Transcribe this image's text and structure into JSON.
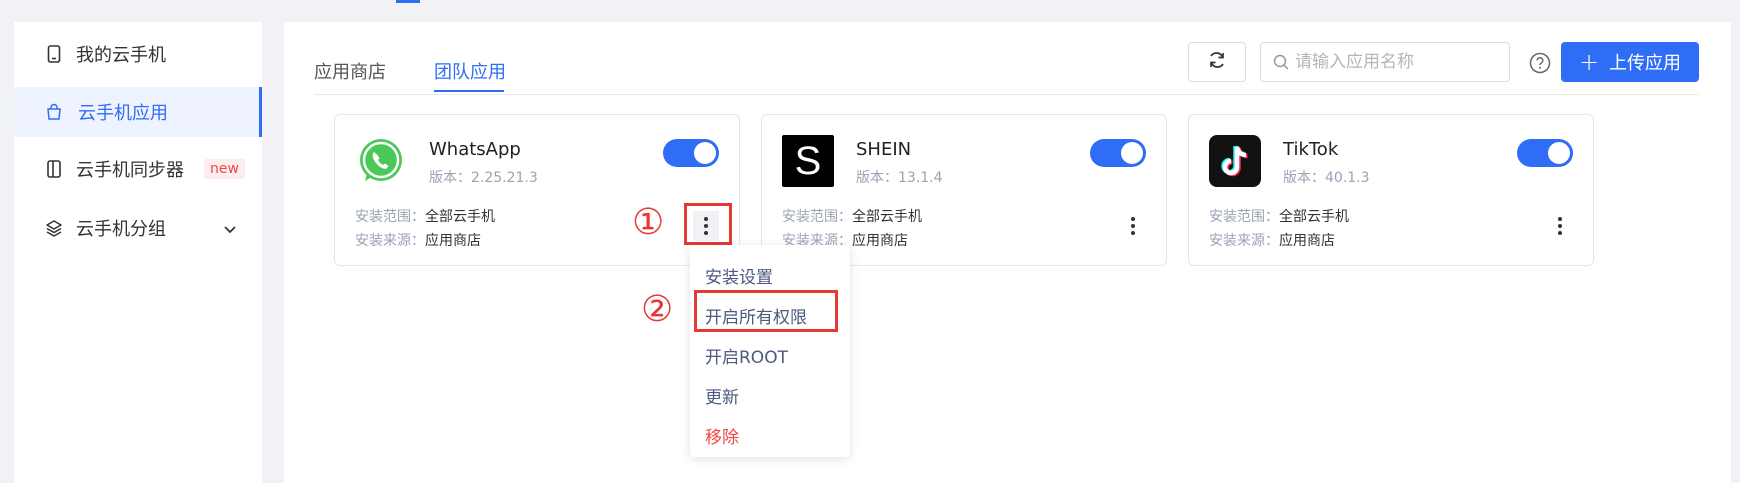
{
  "sidebar": {
    "items": [
      {
        "label": "我的云手机"
      },
      {
        "label": "云手机应用"
      },
      {
        "label": "云手机同步器",
        "badge": "new"
      },
      {
        "label": "云手机分组"
      }
    ]
  },
  "tabs": [
    {
      "label": "应用商店"
    },
    {
      "label": "团队应用"
    }
  ],
  "search": {
    "placeholder": "请输入应用名称"
  },
  "upload_label": "上传应用",
  "apps": [
    {
      "name": "WhatsApp",
      "version_label": "版本：",
      "version": "2.25.21.3",
      "scope_label": "安装范围：",
      "scope": "全部云手机",
      "source_label": "安装来源：",
      "source": "应用商店",
      "enabled": true
    },
    {
      "name": "SHEIN",
      "version_label": "版本：",
      "version": "13.1.4",
      "scope_label": "安装范围：",
      "scope": "全部云手机",
      "source_label": "安装来源：",
      "source": "应用商店",
      "enabled": true,
      "icon_letter": "S"
    },
    {
      "name": "TikTok",
      "version_label": "版本：",
      "version": "40.1.3",
      "scope_label": "安装范围：",
      "scope": "全部云手机",
      "source_label": "安装来源：",
      "source": "应用商店",
      "enabled": true
    }
  ],
  "annotations": {
    "step1": "①",
    "step2": "②"
  },
  "menu": {
    "items": [
      {
        "label": "安装设置"
      },
      {
        "label": "开启所有权限"
      },
      {
        "label": "开启ROOT"
      },
      {
        "label": "更新"
      },
      {
        "label": "移除"
      }
    ]
  },
  "colors": {
    "accent": "#2f6df6",
    "danger": "#f24545",
    "annotation": "#e53935"
  }
}
